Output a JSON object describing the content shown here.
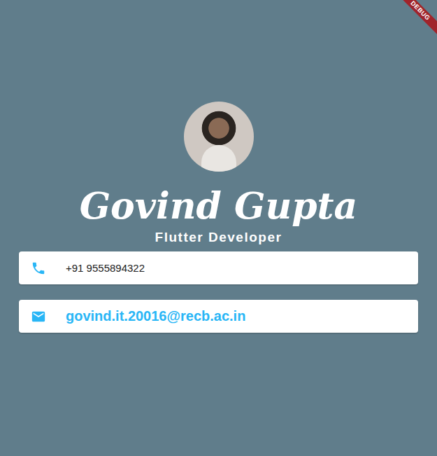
{
  "debug_banner": "DEBUG",
  "profile": {
    "name": "Govind Gupta",
    "title": "Flutter Developer"
  },
  "contacts": [
    {
      "kind": "phone",
      "value": "+91 9555894322"
    },
    {
      "kind": "email",
      "value": "govind.it.20016@recb.ac.in"
    }
  ]
}
